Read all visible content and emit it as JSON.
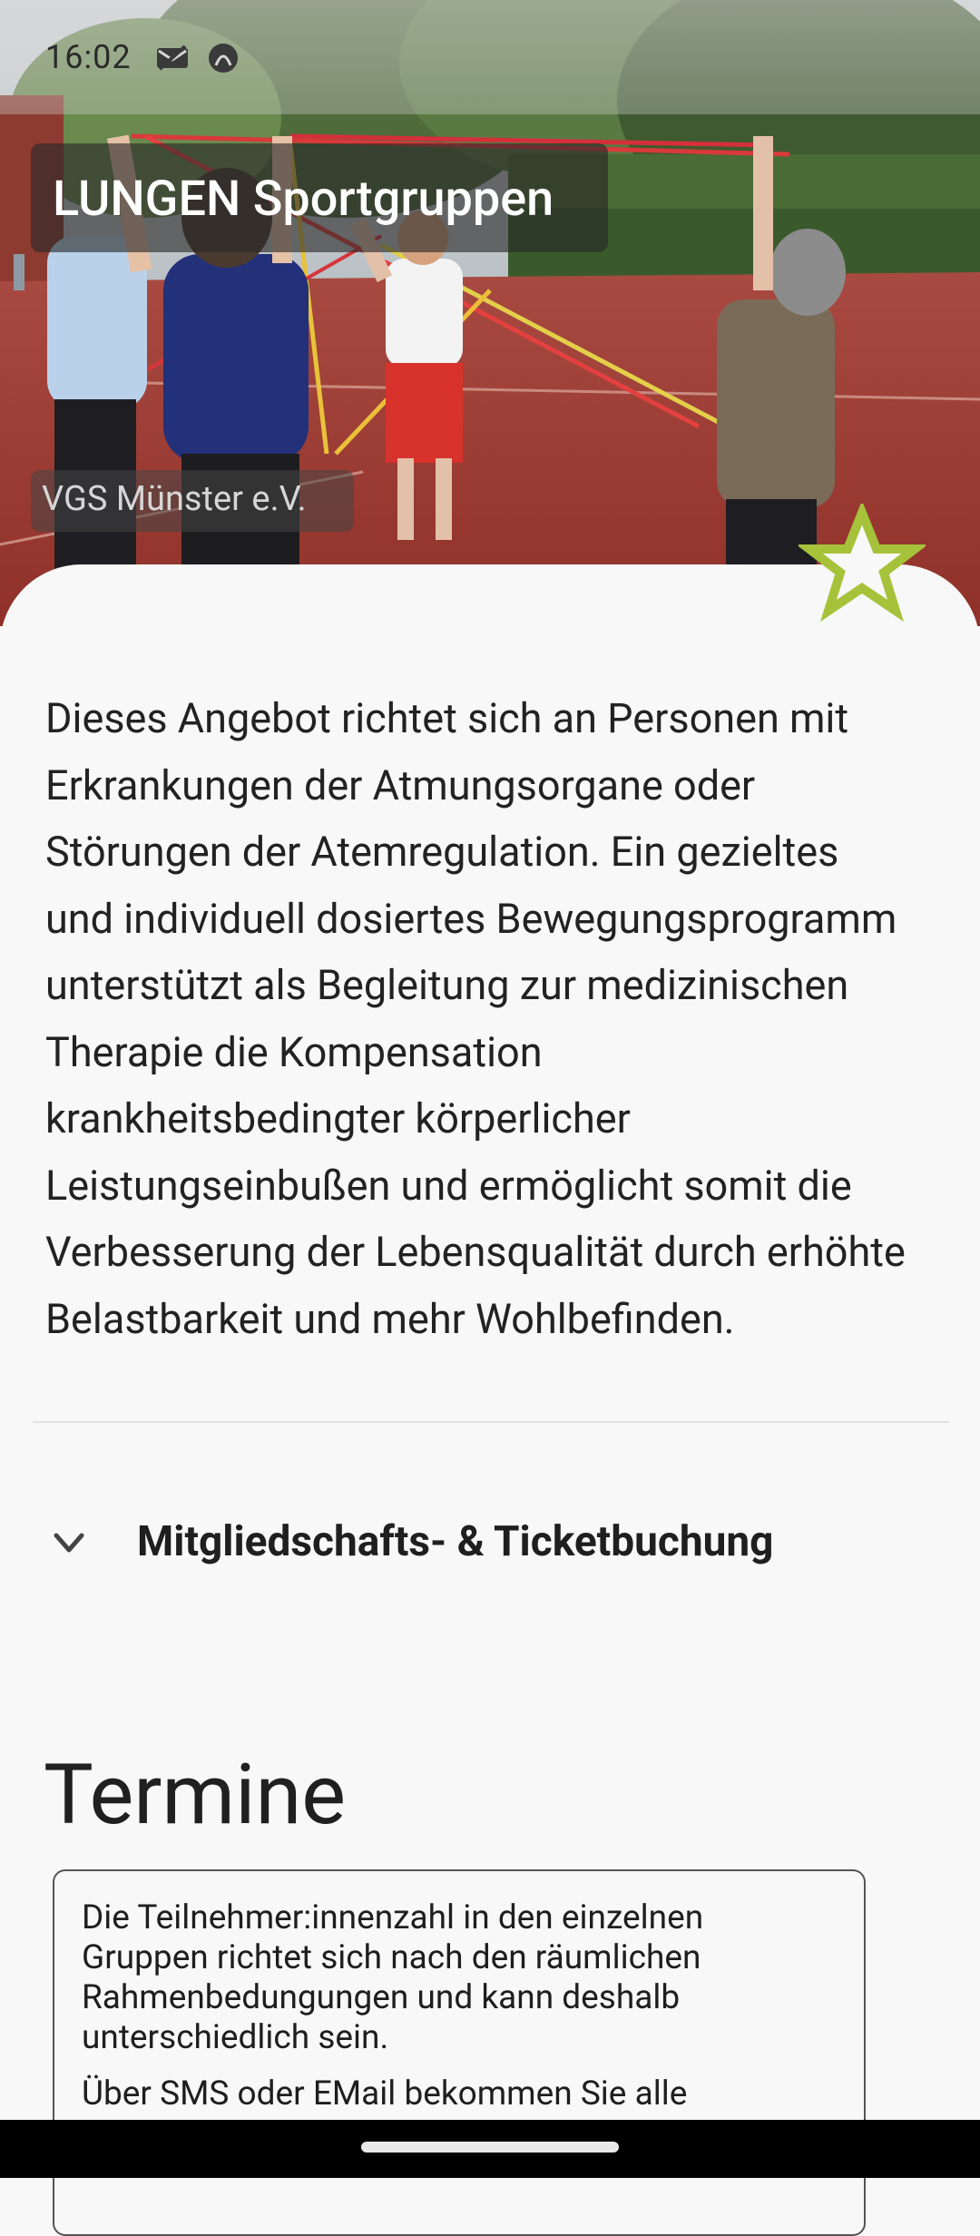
{
  "status_bar": {
    "time": "16:02",
    "icons": [
      "mail-off-icon",
      "app-notification-icon"
    ]
  },
  "header": {
    "title": "LUNGEN Sportgruppen",
    "organization": "VGS Münster e.V."
  },
  "favorite": {
    "icon": "star-outline-icon",
    "color": "#a6c23a"
  },
  "description": "Dieses Angebot richtet sich an Personen mit\nErkrankungen der Atmungsorgane oder\nStörungen der Atemregulation. Ein gezieltes\nund individuell dosiertes Bewegungsprogramm\nunterstützt als Begleitung zur medizinischen\nTherapie die Kompensation\nkrankheitsbedingter körperlicher\nLeistungseinbußen und ermöglicht somit die\nVerbesserung der Lebensqualität durch erhöhte\nBelastbarkeit und mehr Wohlbefinden.",
  "membership": {
    "label": "Mitgliedschafts- & Ticketbuchung",
    "icon": "chevron-down-icon"
  },
  "schedule": {
    "title": "Termine",
    "info_p1": "Die Teilnehmer:innenzahl in den einzelnen\nGruppen richtet sich nach den räumlichen\nRahmenbedungungen und kann deshalb\nunterschiedlich sein.",
    "info_p2": "Über SMS oder EMail bekommen Sie alle"
  }
}
